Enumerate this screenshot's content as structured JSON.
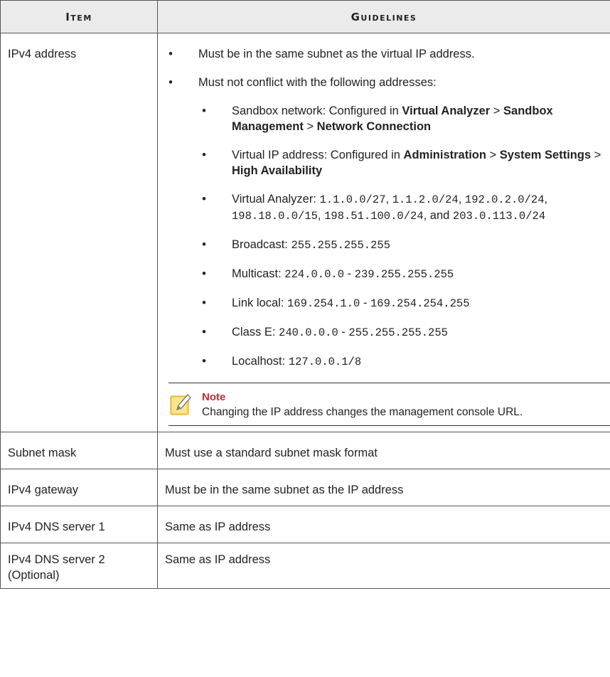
{
  "table": {
    "headers": {
      "item": "Item",
      "guidelines": "Guidelines"
    },
    "ipv4": {
      "item": "IPv4 address",
      "bullet1": "Must be in the same subnet as the virtual IP address.",
      "bullet2": "Must not conflict with the following addresses:",
      "sandbox": {
        "pre": "Sandbox network: Configured in ",
        "a": "Virtual Analyzer",
        "sep": " > ",
        "b": "Sandbox Management",
        "c": "Network Connection"
      },
      "vip": {
        "pre": "Virtual IP address: Configured in ",
        "a": "Administration",
        "sep": " > ",
        "b": "System Settings",
        "c": "High Availability"
      },
      "va": {
        "pre": "Virtual Analyzer: ",
        "n1": "1.1.0.0/27",
        "n2": "1.1.2.0/24",
        "n3": "192.0.2.0/24",
        "n4": "198.18.0.0/15",
        "n5": "198.51.100.0/24",
        "and": "and ",
        "n6": "203.0.113.0/24"
      },
      "broadcast": {
        "pre": "Broadcast: ",
        "v": "255.255.255.255"
      },
      "multicast": {
        "pre": "Multicast: ",
        "a": "224.0.0.0",
        "dash": " - ",
        "b": "239.255.255.255"
      },
      "linklocal": {
        "pre": "Link local: ",
        "a": "169.254.1.0",
        "dash": " - ",
        "b": "169.254.254.255"
      },
      "classe": {
        "pre": "Class E: ",
        "a": "240.0.0.0",
        "dash": " - ",
        "b": "255.255.255.255"
      },
      "localhost": {
        "pre": "Localhost: ",
        "v": "127.0.0.1/8"
      },
      "note": {
        "title": "Note",
        "text": "Changing the IP address changes the management console URL."
      }
    },
    "rows": [
      {
        "item": "Subnet mask",
        "guide": "Must use a standard subnet mask format"
      },
      {
        "item": "IPv4 gateway",
        "guide": "Must be in the same subnet as the IP address"
      },
      {
        "item": "IPv4 DNS server 1",
        "guide": "Same as IP address"
      },
      {
        "item_l1": "IPv4 DNS server 2",
        "item_l2": "(Optional)",
        "guide": "Same as IP address"
      }
    ]
  }
}
